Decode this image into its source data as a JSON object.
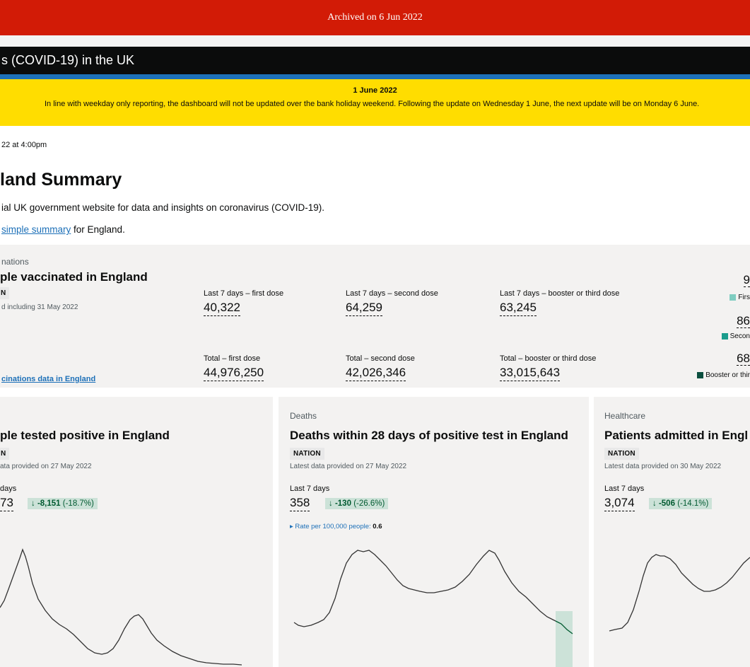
{
  "archive_bar": {
    "text": "Archived on 6 Jun 2022"
  },
  "nav": {
    "title": "s (COVID-19) in the UK"
  },
  "banner": {
    "title": "1 June 2022",
    "text": "In line with weekday only reporting, the dashboard will not be updated over the bank holiday weekend. Following the update on Wednesday 1 June, the next update will be on Monday 6 June."
  },
  "page": {
    "updated": "22 at 4:00pm",
    "heading": "land Summary",
    "intro": "ial UK government website for data and insights on coronavirus (COVID-19).",
    "summary_link": "simple summary",
    "summary_suffix": " for England."
  },
  "vaccinations": {
    "caption": "nations",
    "title": "ple vaccinated in England",
    "tag": "N",
    "date_note": "d including 31 May 2022",
    "metrics": [
      {
        "label": "Last 7 days – first dose",
        "value": "40,322"
      },
      {
        "label": "Last 7 days – second dose",
        "value": "64,259"
      },
      {
        "label": "Last 7 days – booster or third dose",
        "value": "63,245"
      },
      {
        "label": "Total – first dose",
        "value": "44,976,250"
      },
      {
        "label": "Total – second dose",
        "value": "42,026,346"
      },
      {
        "label": "Total – booster or third dose",
        "value": "33,015,643"
      }
    ],
    "link": "cinations data in England",
    "side": [
      {
        "value": "9",
        "legend": "Firs",
        "color": "#7fcdc1"
      },
      {
        "value": "86",
        "legend": "Secon",
        "color": "#1a9c8c"
      },
      {
        "value": "68",
        "legend": "Booster or thir",
        "color": "#0b4f3f"
      }
    ]
  },
  "cards": [
    {
      "caption": "",
      "title": "ple tested positive in England",
      "tag": "N",
      "latest": "ata provided on 27 May 2022",
      "period": "days",
      "value": "73",
      "change_value": "-8,151",
      "change_pct": "(-18.7%)"
    },
    {
      "caption": "Deaths",
      "title": "Deaths within 28 days of positive test in England",
      "tag": "NATION",
      "latest": "Latest data provided on 27 May 2022",
      "period": "Last 7 days",
      "value": "358",
      "change_value": "-130",
      "change_pct": "(-26.6%)",
      "rate_label": "Rate per 100,000 people: ",
      "rate_value": "0.6"
    },
    {
      "caption": "Healthcare",
      "title": "Patients admitted in Engl",
      "tag": "NATION",
      "latest": "Latest data provided on 30 May 2022",
      "period": "Last 7 days",
      "value": "3,074",
      "change_value": "-506",
      "change_pct": "(-14.1%)"
    }
  ],
  "colors": {
    "archive_red": "#d21b06",
    "banner_yellow": "#ffdd00",
    "nav_blue": "#1d70b8",
    "positive_green": "#005a30",
    "change_bg": "#cce2d8"
  }
}
